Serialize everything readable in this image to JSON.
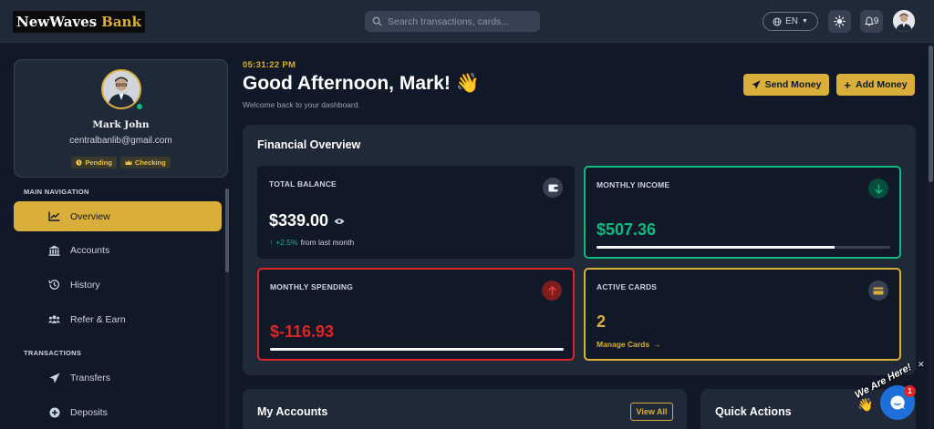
{
  "brand": {
    "name_part1": "NewWaves",
    "name_part2": "Bank"
  },
  "search": {
    "placeholder": "Search transactions, cards..."
  },
  "header": {
    "language": "EN",
    "notification_count": "9"
  },
  "profile": {
    "name": "Mark John",
    "email": "centralbanlib@gmail.com",
    "badges": [
      "Pending",
      "Checking"
    ]
  },
  "sidebar": {
    "sections": [
      {
        "title": "MAIN NAVIGATION"
      },
      {
        "title": "TRANSACTIONS"
      }
    ],
    "items": [
      {
        "label": "Overview",
        "icon": "chart-line-icon",
        "active": true
      },
      {
        "label": "Accounts",
        "icon": "bank-icon"
      },
      {
        "label": "History",
        "icon": "history-icon"
      },
      {
        "label": "Refer & Earn",
        "icon": "users-icon"
      },
      {
        "label": "Transfers",
        "icon": "paper-plane-icon"
      },
      {
        "label": "Deposits",
        "icon": "plus-circle-icon"
      }
    ]
  },
  "main": {
    "time": "05:31:22 PM",
    "greeting": "Good Afternoon, Mark! 👋",
    "subtitle": "Welcome back to your dashboard.",
    "actions": {
      "send": "Send Money",
      "add": "Add Money"
    }
  },
  "overview": {
    "title": "Financial Overview",
    "total_balance": {
      "label": "TOTAL BALANCE",
      "value": "$339.00",
      "change": "+2.5%",
      "change_suffix": "from last month"
    },
    "monthly_income": {
      "label": "MONTHLY INCOME",
      "value": "$507.36",
      "progress": 0.81
    },
    "monthly_spending": {
      "label": "MONTHLY SPENDING",
      "value": "$-116.93",
      "progress": 1.0
    },
    "active_cards": {
      "label": "ACTIVE CARDS",
      "value": "2",
      "link": "Manage Cards"
    }
  },
  "panels": {
    "accounts_title": "My Accounts",
    "view_all": "View All",
    "quick_actions_title": "Quick Actions"
  },
  "chat": {
    "text": "We Are Here!",
    "badge": "1"
  },
  "colors": {
    "accent": "#d9ae3a",
    "income": "#10b981",
    "spending": "#dc2626",
    "background": "#111827",
    "panel": "#1f2937"
  }
}
